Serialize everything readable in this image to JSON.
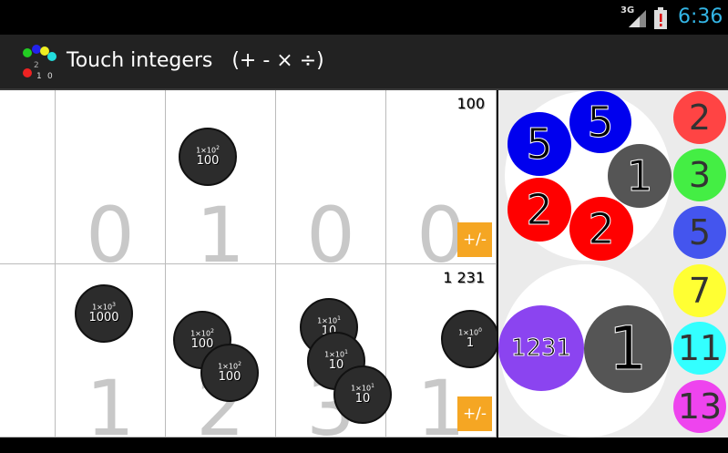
{
  "status": {
    "network": "3G",
    "time": "6:36"
  },
  "app": {
    "title": "Touch integers   (+ - × ÷)"
  },
  "board": {
    "rows": [
      {
        "digits": [
          "",
          "0",
          "1",
          "0",
          "0"
        ],
        "value": "100",
        "sign_button": "+/-",
        "chips": [
          {
            "power": "2",
            "value": "100"
          }
        ]
      },
      {
        "digits": [
          "",
          "1",
          "2",
          "3",
          "1"
        ],
        "value": "1 231",
        "sign_button": "+/-",
        "chips": [
          {
            "power": "3",
            "value": "1000"
          },
          {
            "power": "2",
            "value": "100"
          },
          {
            "power": "2",
            "value": "100"
          },
          {
            "power": "1",
            "value": "10"
          },
          {
            "power": "1",
            "value": "10"
          },
          {
            "power": "1",
            "value": "10"
          },
          {
            "power": "0",
            "value": "1"
          }
        ]
      }
    ],
    "chip_base": "1×10"
  },
  "factor_panel": {
    "top": [
      "5",
      "5",
      "1",
      "2",
      "2"
    ],
    "bottom": [
      "1231",
      "1"
    ]
  },
  "primes": [
    "2",
    "3",
    "5",
    "7",
    "11",
    "13"
  ],
  "colors": {
    "red": "#ff0000",
    "blue": "#0000ee",
    "gray": "#555555",
    "purple": "#8b44f0",
    "sign_orange": "#f5a623",
    "clock_blue": "#33b5e5",
    "prime_colors": [
      "#ff4444",
      "#44ee44",
      "#4455ee",
      "#ffff33",
      "#33ffff",
      "#ee44ee"
    ]
  }
}
